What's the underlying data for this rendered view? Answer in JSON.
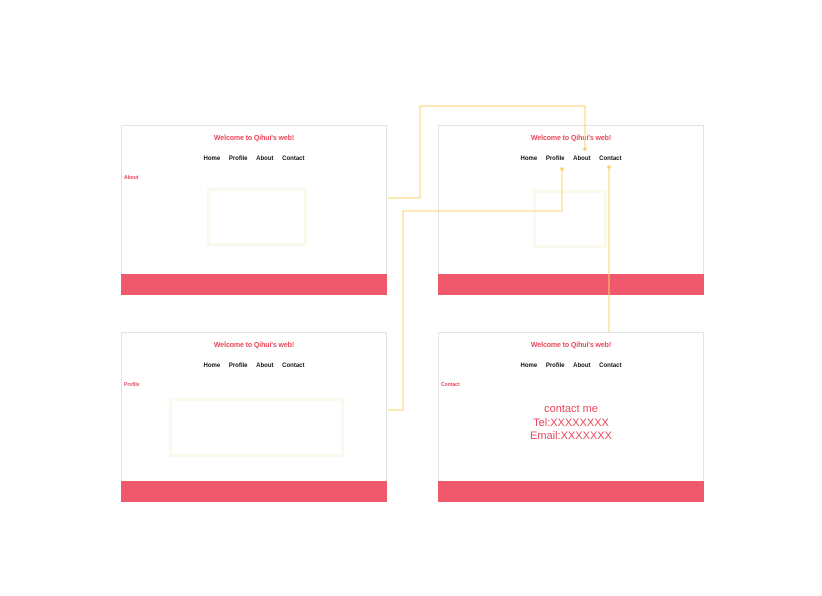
{
  "site": {
    "title": "Welcome to Qihui's web!",
    "nav": [
      "Home",
      "Profile",
      "About",
      "Contact"
    ]
  },
  "pages": {
    "about": {
      "label": "About"
    },
    "home": {
      "label": ""
    },
    "profile": {
      "label": "Profile"
    },
    "contact": {
      "label": "Contact",
      "lines": [
        "contact me",
        "Tel:XXXXXXXX",
        "Email:XXXXXXX"
      ]
    }
  },
  "colors": {
    "accent": "#e9485c",
    "footer": "#f0586b",
    "connector": "#f9d36b",
    "frame_border": "#e3e3e3",
    "placeholder": "#fbf8ec"
  }
}
